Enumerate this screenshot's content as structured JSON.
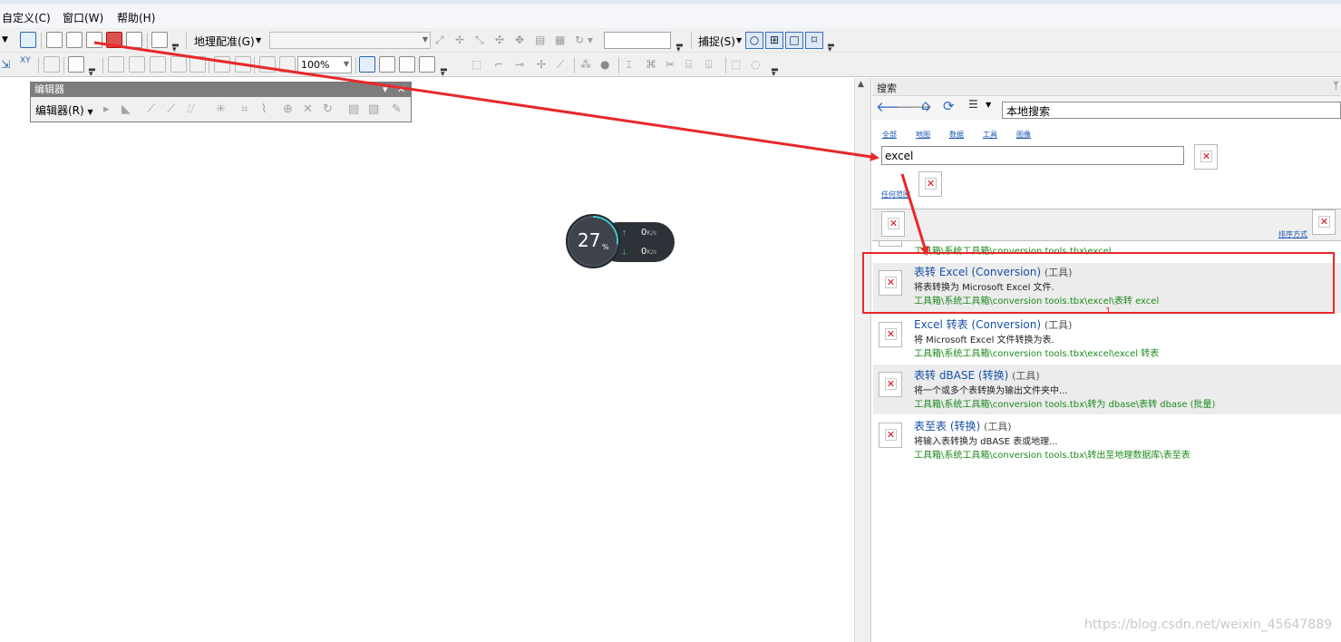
{
  "menubar": {
    "items": [
      "自定义(C)",
      "窗口(W)",
      "帮助(H)"
    ]
  },
  "toolbar1": {
    "georef_label": "地理配准(G)",
    "snap_label": "捕捉(S)"
  },
  "toolbar2": {
    "zoom_value": "100%"
  },
  "editor": {
    "title": "编辑器",
    "menu_label": "编辑器(R)"
  },
  "speed_widget": {
    "percent": "27",
    "percent_unit": "%",
    "up_value": "0",
    "down_value": "0",
    "rate_unit": "K/s"
  },
  "search_panel": {
    "title": "搜索",
    "scope": "本地搜索",
    "filters": [
      "全部",
      "地图",
      "数据",
      "工具",
      "图像"
    ],
    "query": "excel",
    "advanced_link": "任何范围",
    "sort_link": "排序方式",
    "partial_path": "工具箱\\系统工具箱\\conversion tools.tbx\\excel",
    "results": [
      {
        "title": "表转 Excel (Conversion)",
        "tag": "(工具)",
        "desc": "将表转换为 Microsoft Excel 文件.",
        "path": "工具箱\\系统工具箱\\conversion tools.tbx\\excel\\表转 excel"
      },
      {
        "title": "Excel 转表 (Conversion)",
        "tag": "(工具)",
        "desc": "将 Microsoft Excel 文件转换为表.",
        "path": "工具箱\\系统工具箱\\conversion tools.tbx\\excel\\excel 转表"
      },
      {
        "title": "表转 dBASE (转换)",
        "tag": "(工具)",
        "desc": "将一个或多个表转换为输出文件夹中...",
        "path": "工具箱\\系统工具箱\\conversion tools.tbx\\转为 dbase\\表转 dbase (批量)"
      },
      {
        "title": "表至表 (转换)",
        "tag": "(工具)",
        "desc": "将输入表转换为 dBASE 表或地理...",
        "path": "工具箱\\系统工具箱\\conversion tools.tbx\\转出至地理数据库\\表至表"
      }
    ]
  },
  "annotations": {
    "number": "1",
    "color": "#e8282a"
  },
  "watermark": "https://blog.csdn.net/weixin_45647889"
}
